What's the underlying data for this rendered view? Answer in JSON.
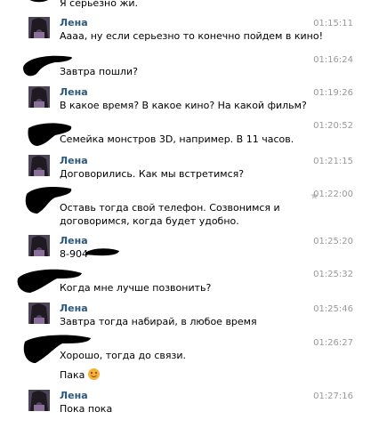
{
  "messages": [
    {
      "author": "",
      "time": "",
      "text": "Я серьезно жи."
    },
    {
      "author": "Лена",
      "time": "01:15:11",
      "text": "Аааа, ну если серьезно то конечно пойдем в кино!"
    },
    {
      "author": "",
      "time": "01:16:24",
      "text": "Завтра пошли?"
    },
    {
      "author": "Лена",
      "time": "01:19:26",
      "text": "В какое время? В какое кино? На какой фильм?"
    },
    {
      "author": "",
      "time": "01:20:52",
      "text": "Семейка монстров 3D, например. В 11 часов."
    },
    {
      "author": "Лена",
      "time": "01:21:15",
      "text": "Договорились. Как мы встретимся?"
    },
    {
      "author": "",
      "time": "01:22:00",
      "text": "Оставь тогда свой телефон. Созвонимся и договоримся, когда будет удобно."
    },
    {
      "author": "Лена",
      "time": "01:25:20",
      "text": "8-904"
    },
    {
      "author": "",
      "time": "01:25:32",
      "text": "Когда мне лучше позвонить?"
    },
    {
      "author": "Лена",
      "time": "01:25:46",
      "text": "Завтра тогда набирай, в любое время"
    },
    {
      "author": "",
      "time": "01:26:27",
      "text": "Хорошо, тогда до связи."
    },
    {
      "author": "",
      "time": "",
      "text": "Пака"
    },
    {
      "author": "Лена",
      "time": "01:27:16",
      "text": "Пока пока"
    }
  ],
  "icons": {
    "favorite": "star-icon",
    "smile": "smile-emoji-icon"
  },
  "colors": {
    "name": "#2b587a",
    "time": "#999999",
    "scribble": "#000000"
  }
}
